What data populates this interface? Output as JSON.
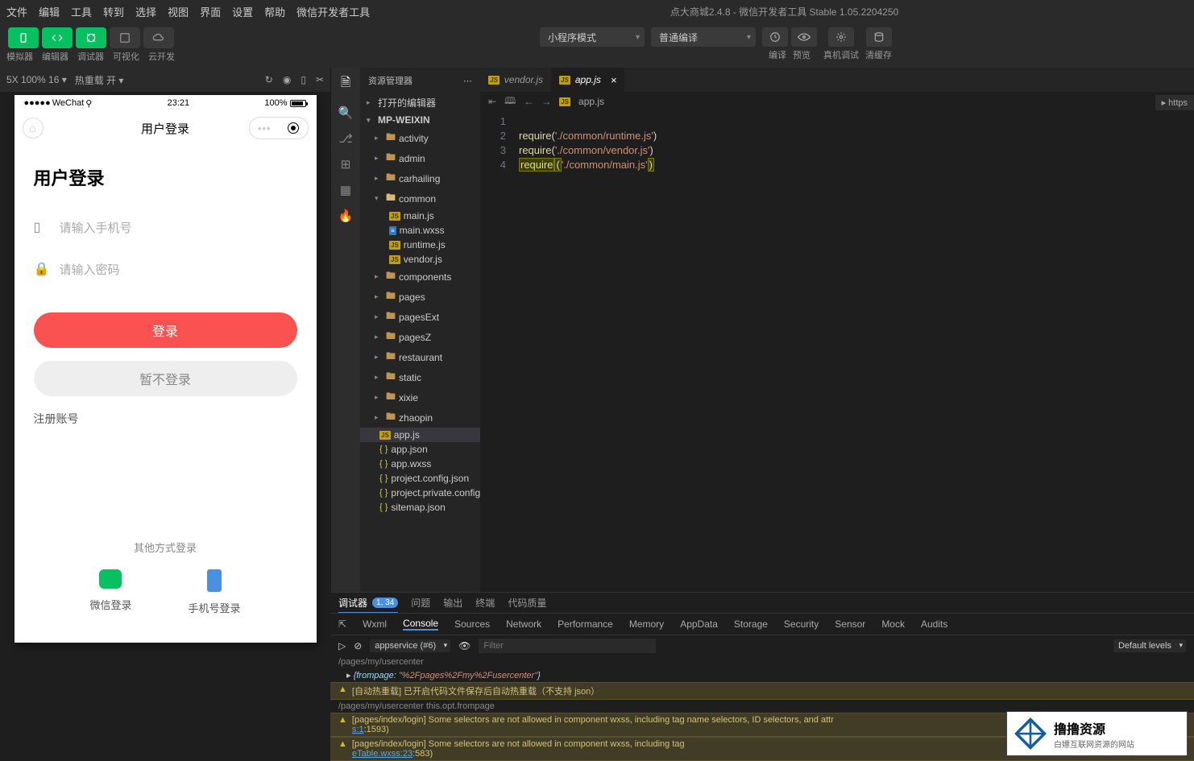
{
  "menubar": {
    "items": [
      "文件",
      "编辑",
      "工具",
      "转到",
      "选择",
      "视图",
      "界面",
      "设置",
      "帮助",
      "微信开发者工具"
    ],
    "title_left": "点大商城2.4.8",
    "title_right": "微信开发者工具 Stable 1.05.2204250"
  },
  "toolbar": {
    "labels": [
      "模拟器",
      "编辑器",
      "调试器",
      "可视化",
      "云开发"
    ],
    "mode_dropdown": "小程序模式",
    "compile_dropdown": "普通编译",
    "right_labels": [
      "编译",
      "预览",
      "真机调试",
      "清缓存"
    ]
  },
  "simbar": {
    "zoom": "5X 100% 16",
    "hot": "热重载 开"
  },
  "phone": {
    "carrier": "WeChat",
    "time": "23:21",
    "battery": "100%",
    "nav_title": "用户登录",
    "page_title": "用户登录",
    "phone_ph": "请输入手机号",
    "pwd_ph": "请输入密码",
    "login_btn": "登录",
    "skip_btn": "暂不登录",
    "register": "注册账号",
    "other_title": "其他方式登录",
    "wx_login": "微信登录",
    "ph_login": "手机号登录"
  },
  "explorer": {
    "title": "资源管理器",
    "open_editors": "打开的编辑器",
    "root": "MP-WEIXIN",
    "folders": [
      "activity",
      "admin",
      "carhailing",
      "common",
      "components",
      "pages",
      "pagesExt",
      "pagesZ",
      "restaurant",
      "static",
      "xixie",
      "zhaopin"
    ],
    "common_files": [
      "main.js",
      "main.wxss",
      "runtime.js",
      "vendor.js"
    ],
    "root_files": [
      "app.js",
      "app.json",
      "app.wxss",
      "project.config.json",
      "project.private.config.js...",
      "sitemap.json"
    ]
  },
  "tabs": {
    "vendor": "vendor.js",
    "app": "app.js"
  },
  "breadcrumb": "app.js",
  "code": {
    "lines": [
      {
        "n": "1",
        "t": ""
      },
      {
        "n": "2",
        "req": "require",
        "s": "'./common/runtime.js'"
      },
      {
        "n": "3",
        "req": "require",
        "s": "'./common/vendor.js'"
      },
      {
        "n": "4",
        "req": "require",
        "s": "'./common/main.js'"
      }
    ]
  },
  "side_flag": "https",
  "bottom": {
    "tabs": [
      "调试器",
      "问题",
      "输出",
      "终端",
      "代码质量"
    ],
    "debugger_badge": "1, 34",
    "devtools": [
      "Wxml",
      "Console",
      "Sources",
      "Network",
      "Performance",
      "Memory",
      "AppData",
      "Storage",
      "Security",
      "Sensor",
      "Mock",
      "Audits"
    ],
    "console_scope": "appservice (#6)",
    "filter_ph": "Filter",
    "levels": "Default levels",
    "logs": {
      "l0": "/pages/my/usercenter",
      "obj_k": "{frompage:",
      "obj_v": "\"%2Fpages%2Fmy%2Fusercenter\"",
      "obj_c": "}",
      "warn1": "[自动热重载] 已开启代码文件保存后自动热重载（不支持 json）",
      "l1": "/pages/my/usercenter this.opt.frompage",
      "warn2a": "[pages/index/login] Some selectors are not allowed in component wxss, including tag name selectors, ID selectors, and attr",
      "warn2b": "s:1",
      "warn2c": ":1593)",
      "warn3a": "[pages/index/login] Some selectors are not allowed in component wxss, including tag",
      "warn3b": "eTable.wxss:23",
      "warn3c": ":583)"
    }
  },
  "watermark": {
    "big": "撸撸资源",
    "small": "白嫖互联网资源的网站"
  }
}
